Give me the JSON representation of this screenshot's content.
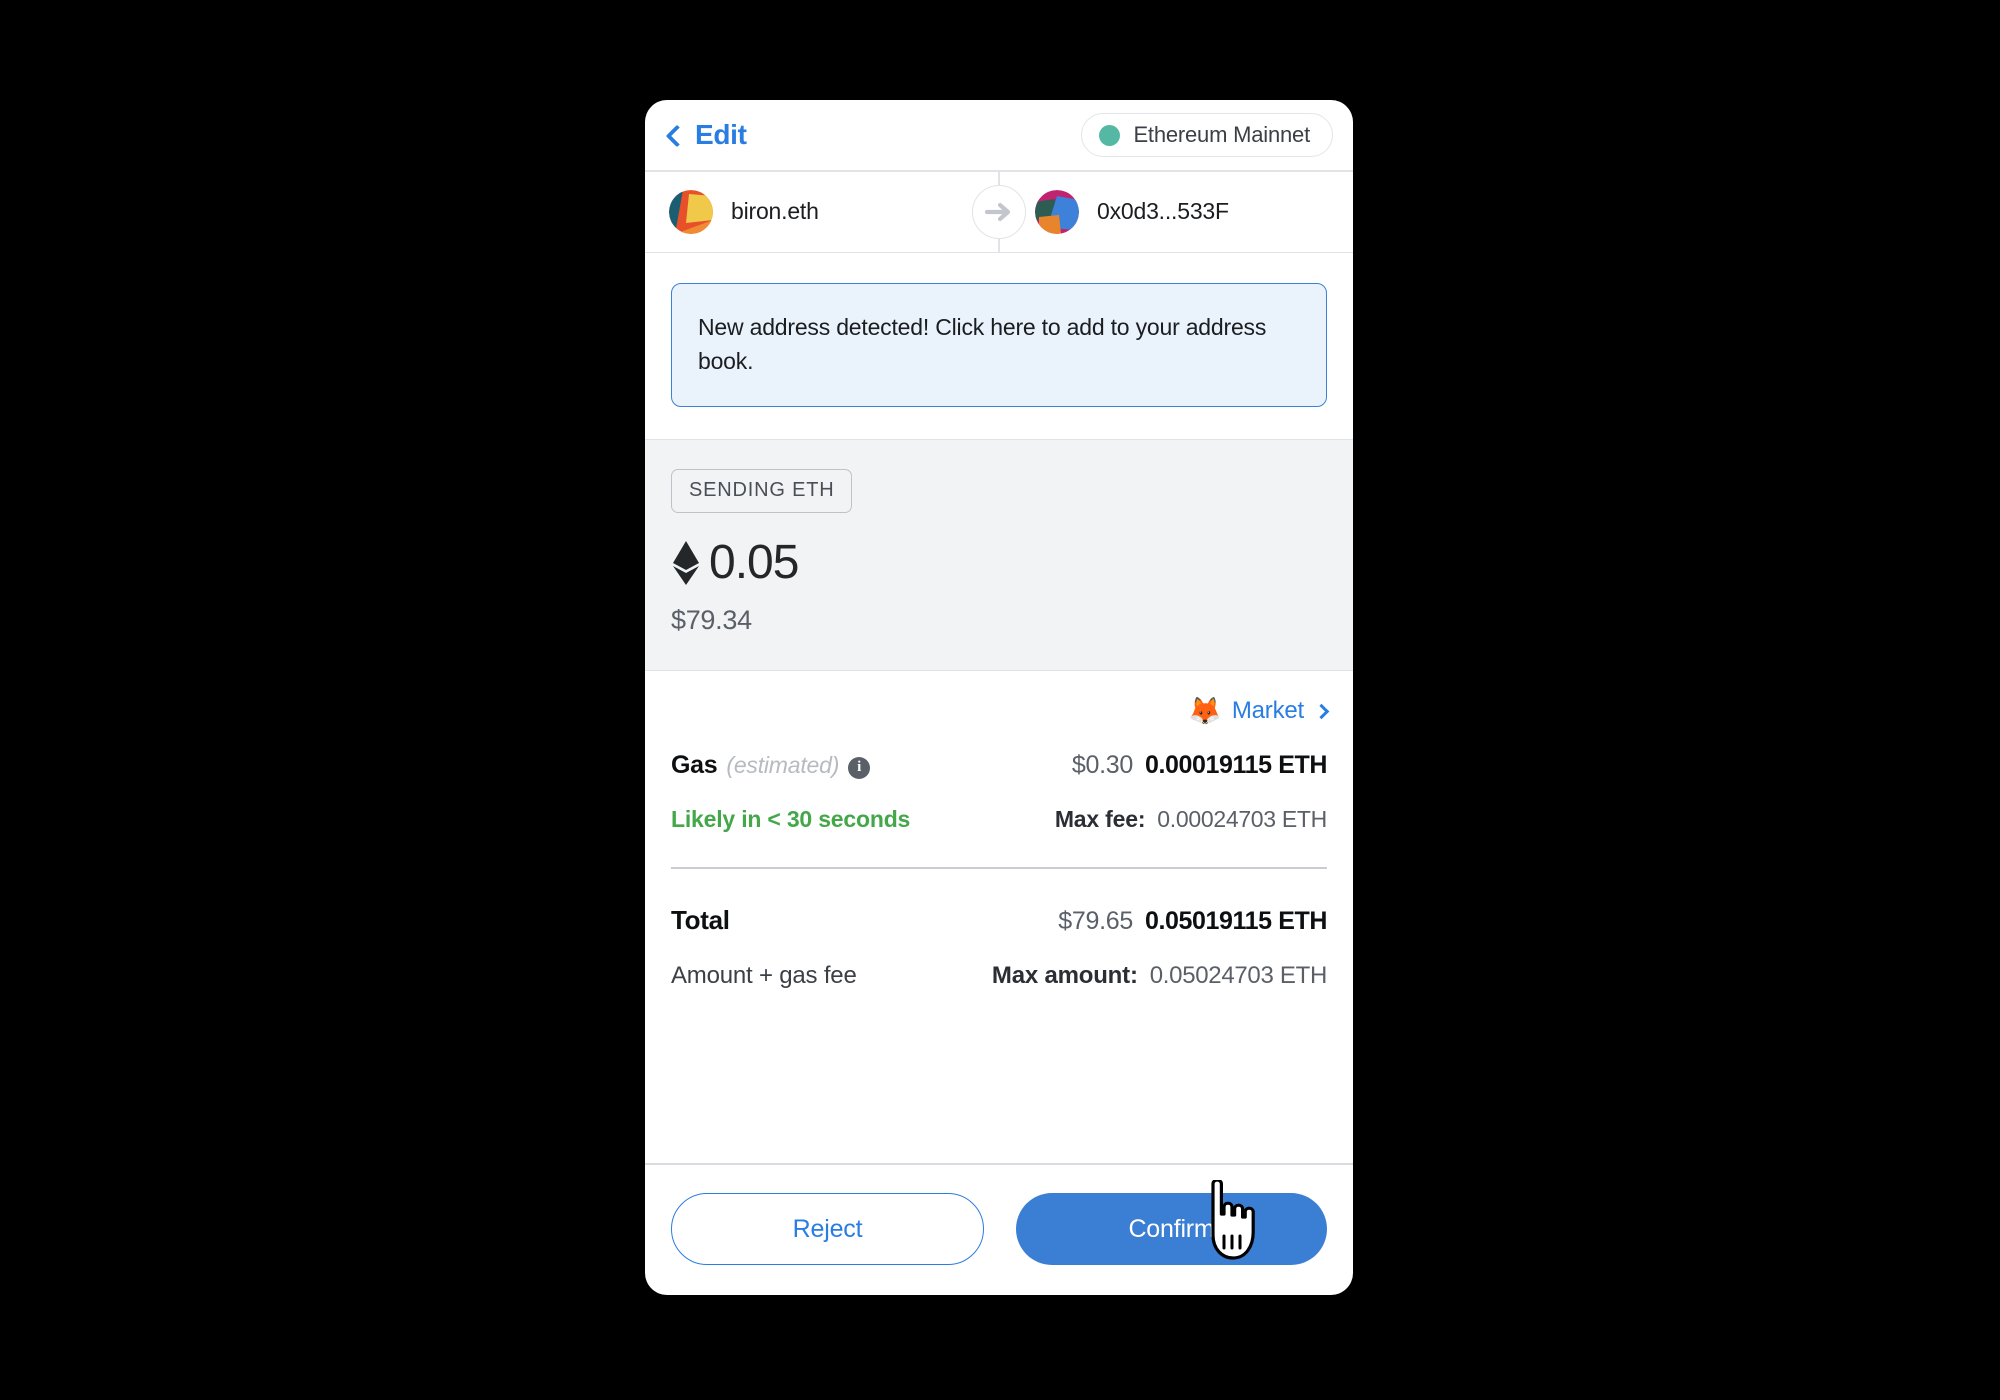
{
  "header": {
    "back_label": "Edit",
    "back_icon": "chevron-left-icon",
    "network_name": "Ethereum Mainnet",
    "network_dot_color": "#54b8a4"
  },
  "transfer": {
    "from_name": "biron.eth",
    "to_name": "0x0d3...533F",
    "arrow_icon": "arrow-right-icon"
  },
  "alert": {
    "message": "New address detected! Click here to add to your address book.",
    "border_color": "#3b82d6",
    "background_color": "#eaf2fb"
  },
  "sending": {
    "badge_label": "SENDING ETH",
    "token_icon": "ethereum-diamond-icon",
    "amount": "0.05",
    "fiat": "$79.34"
  },
  "fees": {
    "market_label": "Market",
    "market_icon": "fox-emoji-icon",
    "market_chevron": "chevron-right-icon",
    "gas_label": "Gas",
    "gas_estimated_label": "(estimated)",
    "gas_info_icon": "info-icon",
    "gas_fiat": "$0.30",
    "gas_eth": "0.00019115 ETH",
    "speed_text": "Likely in < 30 seconds",
    "speed_color": "#44a84a",
    "max_fee_label": "Max fee:",
    "max_fee_value": "0.00024703 ETH"
  },
  "total": {
    "label": "Total",
    "fiat": "$79.65",
    "eth": "0.05019115 ETH",
    "sublabel": "Amount + gas fee",
    "max_amount_label": "Max amount:",
    "max_amount_value": "0.05024703 ETH"
  },
  "footer": {
    "reject_label": "Reject",
    "confirm_label": "Confirm",
    "confirm_color": "#3b7fd4",
    "reject_color": "#2a7de1"
  }
}
